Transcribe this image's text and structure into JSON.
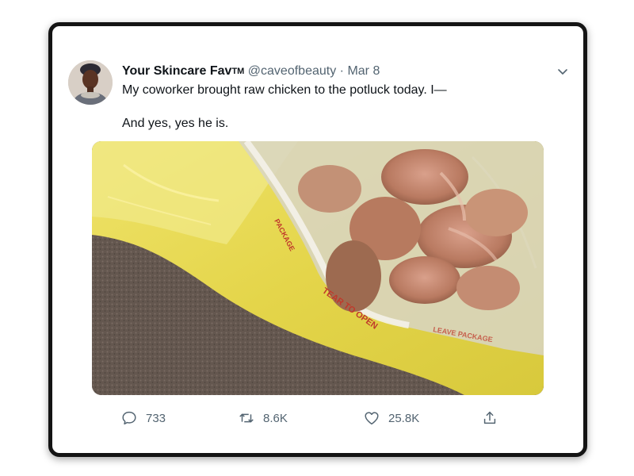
{
  "tweet": {
    "display_name": "Your Skincare Fav",
    "tm": "TM",
    "handle": "@caveofbeauty",
    "separator": "·",
    "date": "Mar 8",
    "text_line1": "My coworker brought raw chicken to the potluck today. I—",
    "text_line2": "And yes, yes he is."
  },
  "photo": {
    "bag_text_1": "TEAR TO OPEN",
    "bag_text_2": "LEAVE PACKAGE",
    "bag_text_3": "PACKAGE"
  },
  "actions": {
    "reply_count": "733",
    "retweet_count": "8.6K",
    "like_count": "25.8K"
  },
  "icons": {
    "reply": "reply-icon",
    "retweet": "retweet-icon",
    "like": "heart-icon",
    "share": "share-icon",
    "more": "chevron-down-icon"
  },
  "colors": {
    "text": "#0f1419",
    "muted": "#536471",
    "frame": "#141414"
  }
}
